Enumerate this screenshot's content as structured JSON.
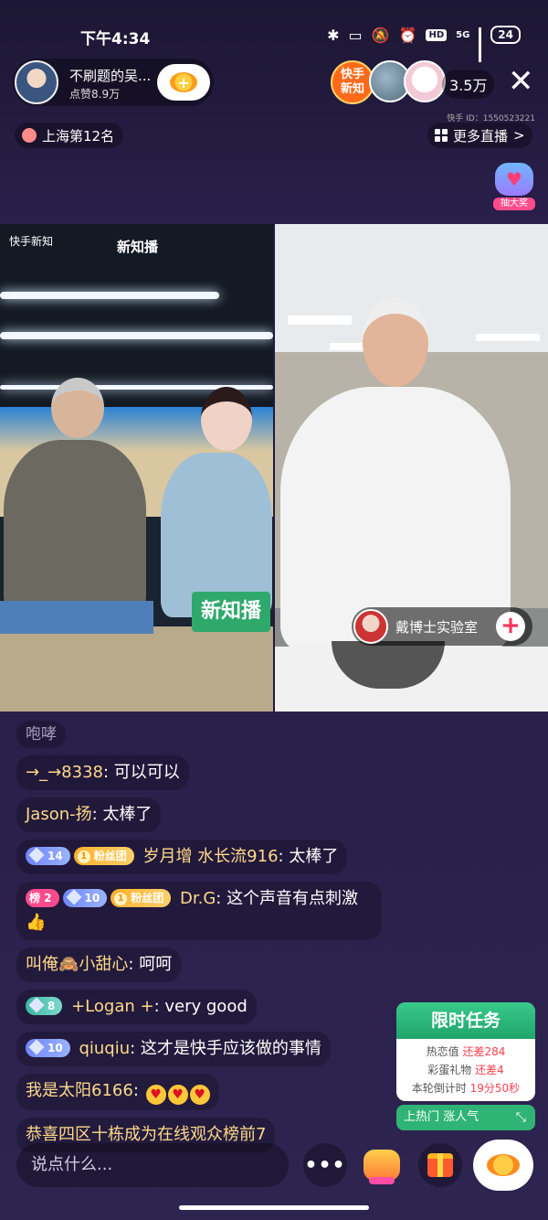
{
  "status": {
    "time": "下午4:34",
    "battery": "24",
    "network": "5G"
  },
  "host": {
    "name": "不刷题的吴...",
    "likes": "点赞8.9万"
  },
  "viewers": {
    "badge": "快手\n新知",
    "count": "3.5万",
    "kuaishou_id": "快手 ID：1550523221"
  },
  "rank": {
    "label": "上海第12名"
  },
  "more_live": {
    "label": "更多直播",
    "arrow": ">"
  },
  "lottery": {
    "label": "抽大奖"
  },
  "video": {
    "left_logo": "快手新知",
    "left_logo2": "新知播",
    "sign": "新知播",
    "pk_name": "戴博士实验室",
    "pk_add": "+"
  },
  "chat": {
    "faded": "咆哮",
    "messages": [
      {
        "user": "→_→8338",
        "text": "可以可以"
      },
      {
        "user": "Jason-扬",
        "text": "太棒了"
      },
      {
        "level": "14",
        "fan": "粉丝团",
        "user": "岁月增 水长流916",
        "text": "太棒了"
      },
      {
        "rank": "榜 2",
        "level": "10",
        "fan": "粉丝团",
        "user": "Dr.G",
        "text": "这个声音有点刺激"
      },
      {
        "user": "叫俺🙈小甜心",
        "text": "呵呵"
      },
      {
        "level": "8",
        "user": "+Logan +",
        "text": "very good"
      },
      {
        "level": "10",
        "user": "qiuqiu",
        "text": "这才是快手应该做的事情"
      },
      {
        "user": "我是太阳6166",
        "text": ""
      },
      {
        "text": "恭喜四区十栋成为在线观众榜前7"
      }
    ]
  },
  "task": {
    "title": "限时任务",
    "row1_label": "热恋值",
    "row1_value": "还差284",
    "row2_label": "彩蛋礼物",
    "row2_value": "还差4",
    "row3_label": "本轮倒计时",
    "row3_value": "19分50秒",
    "footer": "上热门 涨人气"
  },
  "bottom": {
    "input_placeholder": "说点什么...",
    "more": "•••"
  }
}
